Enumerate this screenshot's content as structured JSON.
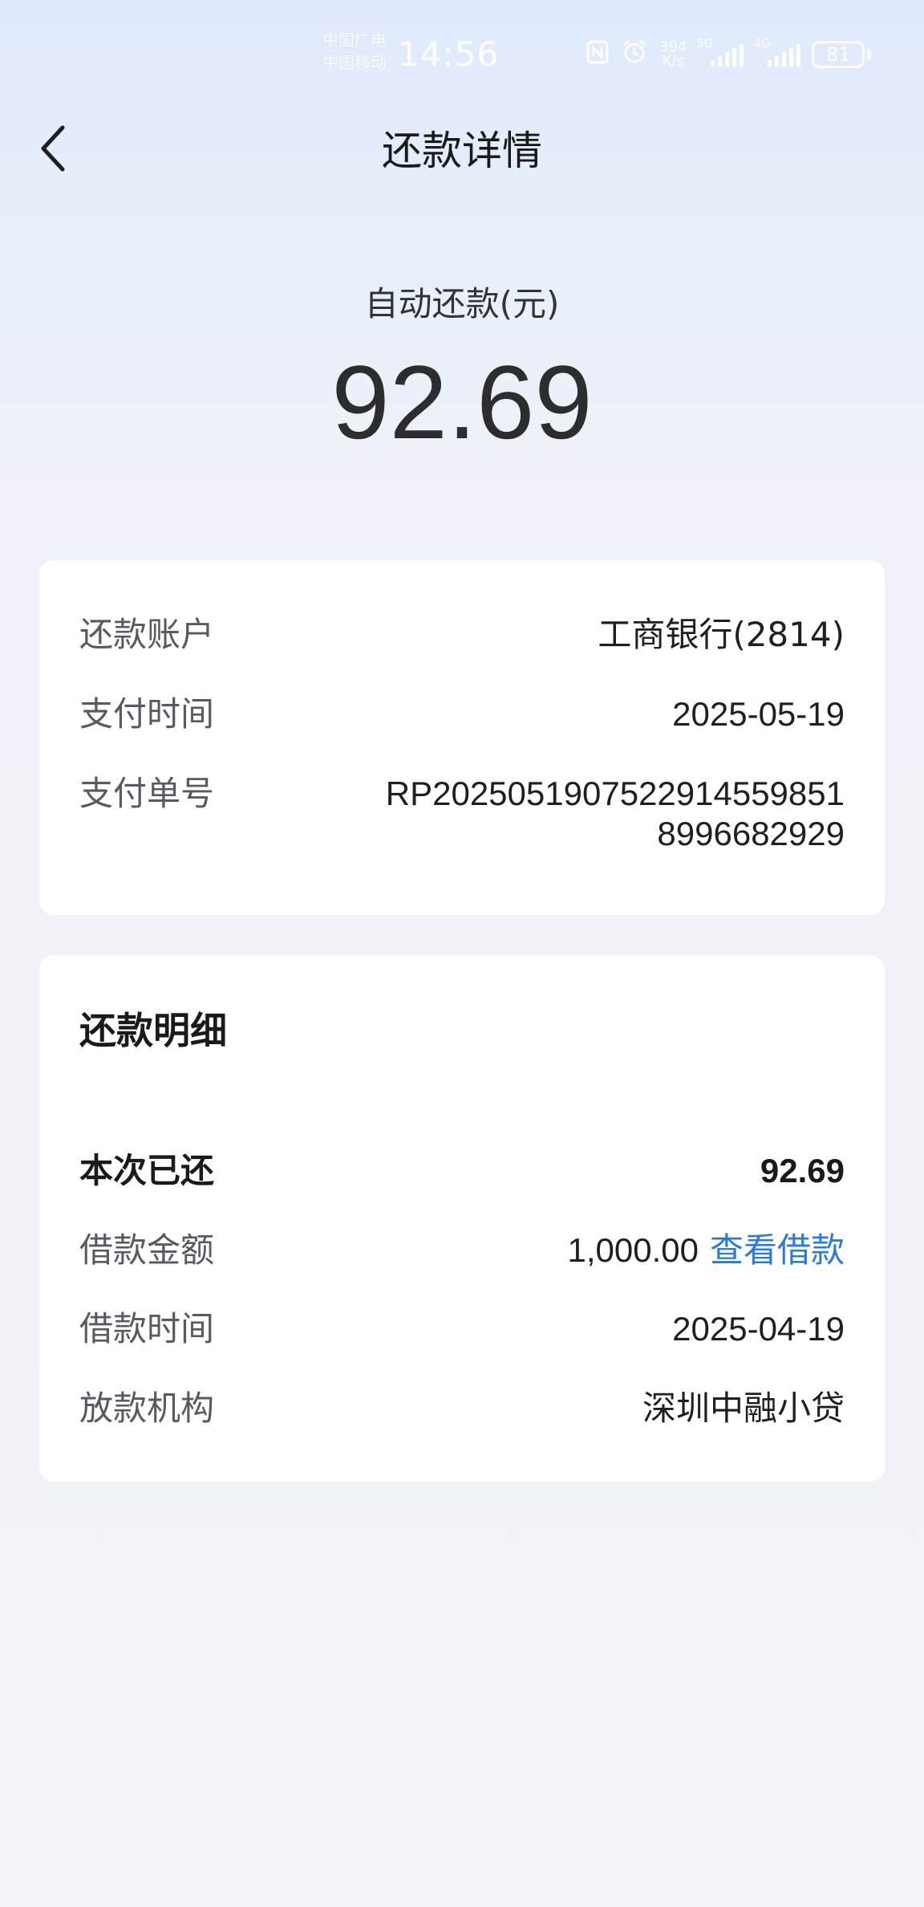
{
  "status_bar": {
    "carrier_1": "中国广电",
    "carrier_2": "中国移动",
    "time": "14:56",
    "net_speed_value": "394",
    "net_speed_unit": "K/s",
    "signal_1_tag": "5G",
    "signal_2_tag": "4G",
    "battery": "81",
    "icons": [
      "nfc-icon",
      "alarm-icon"
    ]
  },
  "header": {
    "title": "还款详情"
  },
  "summary": {
    "label": "自动还款(元)",
    "amount": "92.69"
  },
  "payment_card": {
    "account_label": "还款账户",
    "account_value": "工商银行(2814)",
    "pay_time_label": "支付时间",
    "pay_time_value": "2025-05-19",
    "order_label": "支付单号",
    "order_value": "RP202505190752291455985189966829 29"
  },
  "detail_card": {
    "title": "还款明细",
    "repaid_label": "本次已还",
    "repaid_value": "92.69",
    "loan_amount_label": "借款金额",
    "loan_amount_value": "1,000.00",
    "view_loan_link": "查看借款",
    "loan_time_label": "借款时间",
    "loan_time_value": "2025-04-19",
    "lender_label": "放款机构",
    "lender_value": "深圳中融小贷"
  },
  "colors": {
    "link": "#2a7ad9",
    "background_top": "#dfeafc",
    "background": "#f1f3f8"
  }
}
